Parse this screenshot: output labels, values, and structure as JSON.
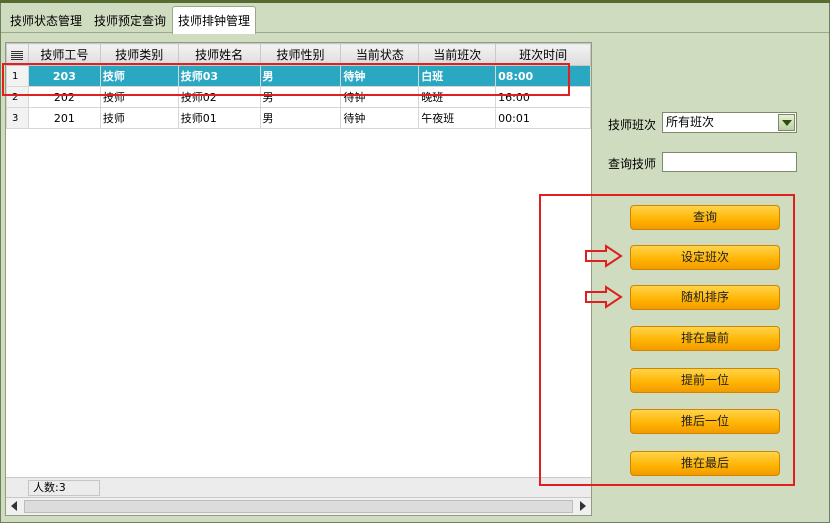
{
  "tabs": [
    {
      "label": "技师状态管理",
      "active": false
    },
    {
      "label": "技师预定查询",
      "active": false
    },
    {
      "label": "技师排钟管理",
      "active": true
    }
  ],
  "grid": {
    "columns": [
      "技师工号",
      "技师类别",
      "技师姓名",
      "技师性别",
      "当前状态",
      "当前班次",
      "班次时间"
    ],
    "rows": [
      {
        "num": "1",
        "cells": [
          "203",
          "技师",
          "技师03",
          "男",
          "待钟",
          "白班",
          "08:00"
        ],
        "selected": true
      },
      {
        "num": "2",
        "cells": [
          "202",
          "技师",
          "技师02",
          "男",
          "待钟",
          "晚班",
          "16:00"
        ],
        "selected": false
      },
      {
        "num": "3",
        "cells": [
          "201",
          "技师",
          "技师01",
          "男",
          "待钟",
          "午夜班",
          "00:01"
        ],
        "selected": false
      }
    ],
    "footer_count": "人数:3"
  },
  "filters": {
    "shift_label": "技师班次",
    "shift_value": "所有班次",
    "search_label": "查询技师",
    "search_value": ""
  },
  "buttons": {
    "query": "查询",
    "set_shift": "设定班次",
    "random_sort": "随机排序",
    "move_first": "排在最前",
    "move_up": "提前一位",
    "move_down": "推后一位",
    "move_last": "推在最后"
  },
  "colors": {
    "panel_bg": "#cfdcbf",
    "selected_row": "#2aa7c1",
    "button_orange": "#ffb300",
    "annotation_red": "#e02020"
  }
}
